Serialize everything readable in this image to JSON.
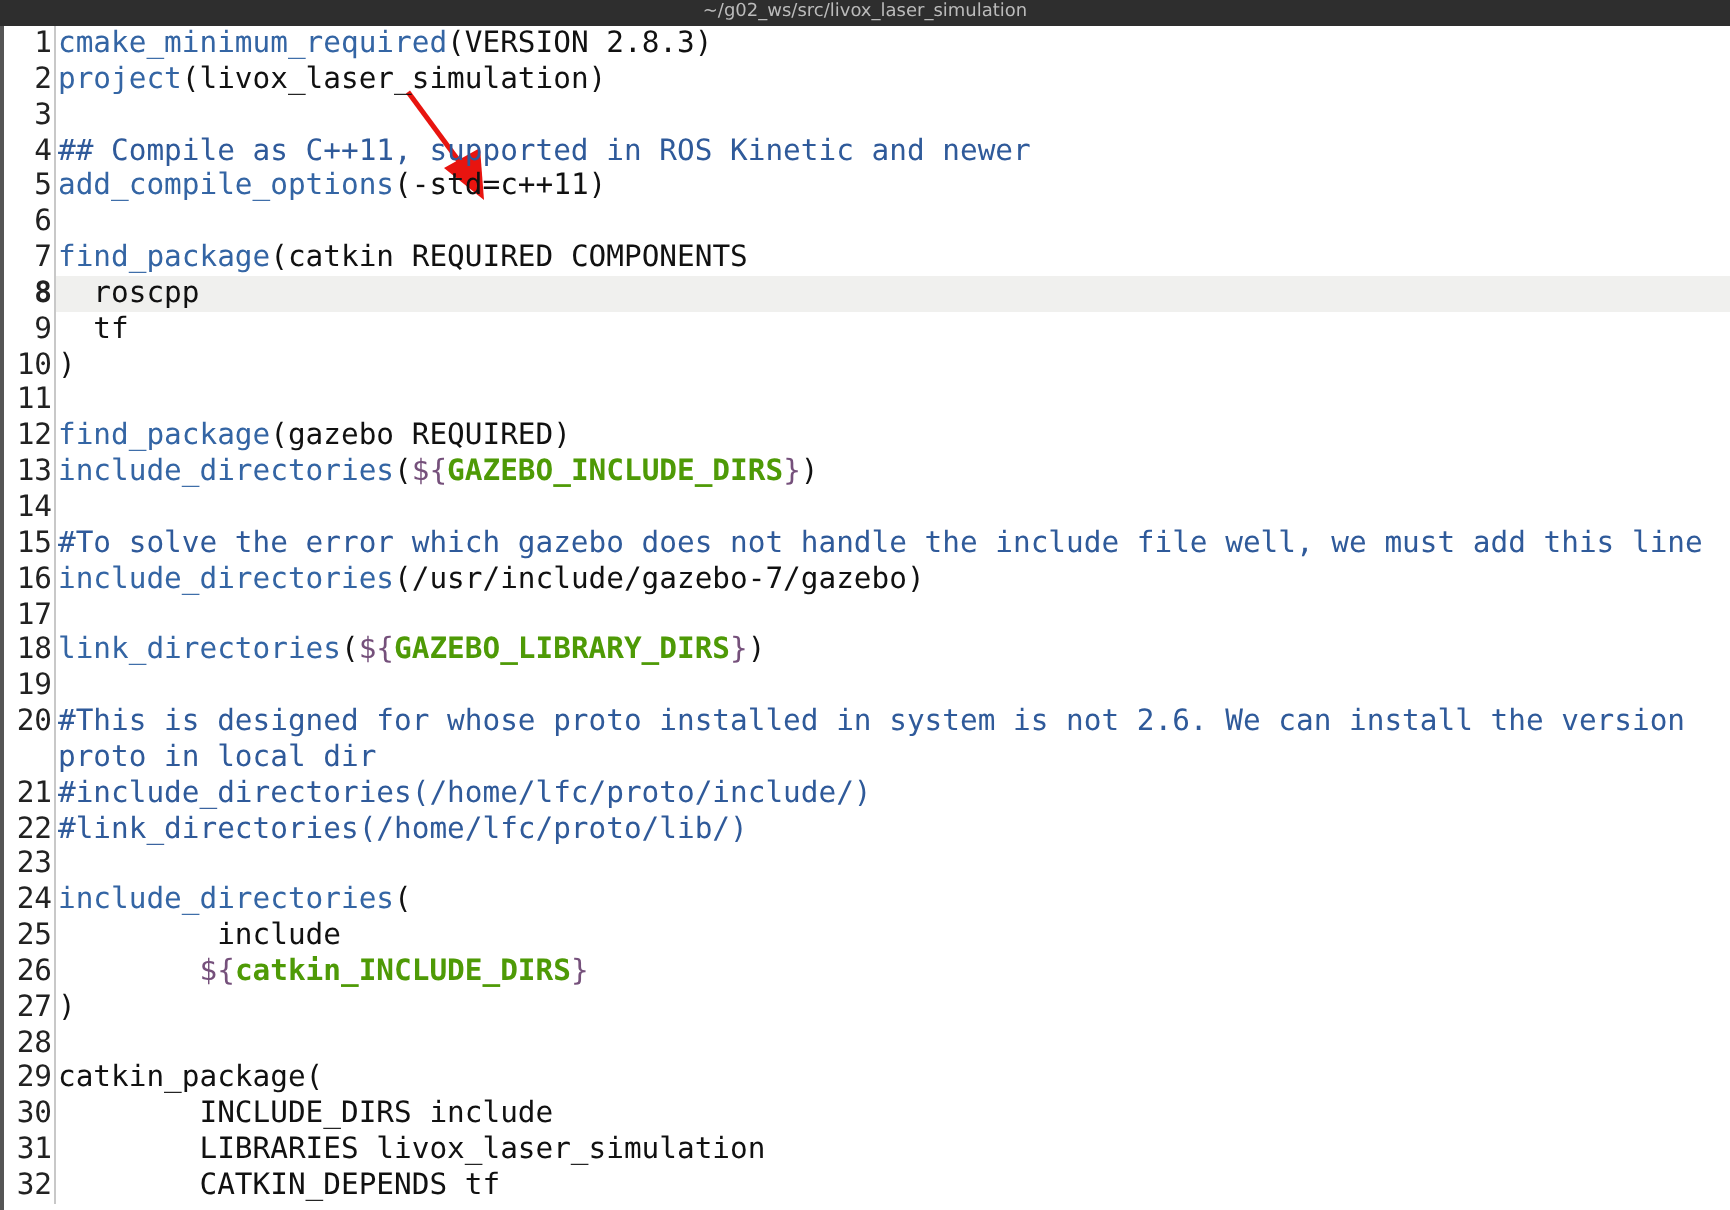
{
  "window": {
    "title": "~/g02_ws/src/livox_laser_simulation"
  },
  "lines": [
    {
      "number": "1",
      "current": false,
      "segments": [
        {
          "kind": "func",
          "text": "cmake_minimum_required"
        },
        {
          "kind": "plain",
          "text": "(VERSION 2.8.3)"
        }
      ]
    },
    {
      "number": "2",
      "current": false,
      "segments": [
        {
          "kind": "func",
          "text": "project"
        },
        {
          "kind": "plain",
          "text": "(livox_laser_simulation)"
        }
      ]
    },
    {
      "number": "3",
      "current": false
    },
    {
      "number": "4",
      "current": false,
      "segments": [
        {
          "kind": "comment",
          "text": "## Compile as C++11, supported in ROS Kinetic and newer"
        }
      ]
    },
    {
      "number": "5",
      "current": false,
      "segments": [
        {
          "kind": "func",
          "text": "add_compile_options"
        },
        {
          "kind": "plain",
          "text": "(-std=c++11)"
        }
      ]
    },
    {
      "number": "6",
      "current": false
    },
    {
      "number": "7",
      "current": false,
      "segments": [
        {
          "kind": "func",
          "text": "find_package"
        },
        {
          "kind": "plain",
          "text": "(catkin REQUIRED COMPONENTS"
        }
      ]
    },
    {
      "number": "8",
      "current": true,
      "segments": [
        {
          "kind": "plain",
          "text": "  roscpp"
        }
      ]
    },
    {
      "number": "9",
      "current": false,
      "segments": [
        {
          "kind": "plain",
          "text": "  tf"
        }
      ]
    },
    {
      "number": "10",
      "current": false,
      "segments": [
        {
          "kind": "plain",
          "text": ")"
        }
      ]
    },
    {
      "number": "11",
      "current": false
    },
    {
      "number": "12",
      "current": false,
      "segments": [
        {
          "kind": "func",
          "text": "find_package"
        },
        {
          "kind": "plain",
          "text": "(gazebo REQUIRED)"
        }
      ]
    },
    {
      "number": "13",
      "current": false,
      "segments": [
        {
          "kind": "func",
          "text": "include_directories"
        },
        {
          "kind": "plain",
          "text": "("
        },
        {
          "kind": "brace",
          "text": "${"
        },
        {
          "kind": "var",
          "text": "GAZEBO_INCLUDE_DIRS"
        },
        {
          "kind": "brace",
          "text": "}"
        },
        {
          "kind": "plain",
          "text": ")"
        }
      ]
    },
    {
      "number": "14",
      "current": false
    },
    {
      "number": "15",
      "current": false,
      "segments": [
        {
          "kind": "comment",
          "text": "#To solve the error which gazebo does not handle the include file well, we must add this line"
        }
      ]
    },
    {
      "number": "16",
      "current": false,
      "segments": [
        {
          "kind": "func",
          "text": "include_directories"
        },
        {
          "kind": "plain",
          "text": "(/usr/include/gazebo-7/gazebo)"
        }
      ]
    },
    {
      "number": "17",
      "current": false
    },
    {
      "number": "18",
      "current": false,
      "segments": [
        {
          "kind": "func",
          "text": "link_directories"
        },
        {
          "kind": "plain",
          "text": "("
        },
        {
          "kind": "brace",
          "text": "${"
        },
        {
          "kind": "var",
          "text": "GAZEBO_LIBRARY_DIRS"
        },
        {
          "kind": "brace",
          "text": "}"
        },
        {
          "kind": "plain",
          "text": ")"
        }
      ]
    },
    {
      "number": "19",
      "current": false
    },
    {
      "number": "20",
      "current": false,
      "segments": [
        {
          "kind": "comment",
          "text": "#This is designed for whose proto installed in system is not 2.6. We can install the version"
        }
      ],
      "wrap": "proto in local dir"
    },
    {
      "number": "21",
      "current": false,
      "segments": [
        {
          "kind": "comment",
          "text": "#include_directories(/home/lfc/proto/include/)"
        }
      ]
    },
    {
      "number": "22",
      "current": false,
      "segments": [
        {
          "kind": "comment",
          "text": "#link_directories(/home/lfc/proto/lib/)"
        }
      ]
    },
    {
      "number": "23",
      "current": false
    },
    {
      "number": "24",
      "current": false,
      "segments": [
        {
          "kind": "func",
          "text": "include_directories"
        },
        {
          "kind": "plain",
          "text": "("
        }
      ]
    },
    {
      "number": "25",
      "current": false,
      "segments": [
        {
          "kind": "plain",
          "text": "         include"
        }
      ]
    },
    {
      "number": "26",
      "current": false,
      "segments": [
        {
          "kind": "brace",
          "text": "        ${"
        },
        {
          "kind": "var",
          "text": "catkin_INCLUDE_DIRS"
        },
        {
          "kind": "brace",
          "text": "}"
        }
      ]
    },
    {
      "number": "27",
      "current": false,
      "segments": [
        {
          "kind": "plain",
          "text": ")"
        }
      ]
    },
    {
      "number": "28",
      "current": false
    },
    {
      "number": "29",
      "current": false,
      "segments": [
        {
          "kind": "plain",
          "text": "catkin_package("
        }
      ]
    },
    {
      "number": "30",
      "current": false,
      "segments": [
        {
          "kind": "plain",
          "text": "        INCLUDE_DIRS include"
        }
      ]
    },
    {
      "number": "31",
      "current": false,
      "segments": [
        {
          "kind": "plain",
          "text": "        LIBRARIES livox_laser_simulation"
        }
      ]
    },
    {
      "number": "32",
      "current": false,
      "segments": [
        {
          "kind": "plain",
          "text": "        CATKIN_DEPENDS tf"
        }
      ]
    }
  ]
}
